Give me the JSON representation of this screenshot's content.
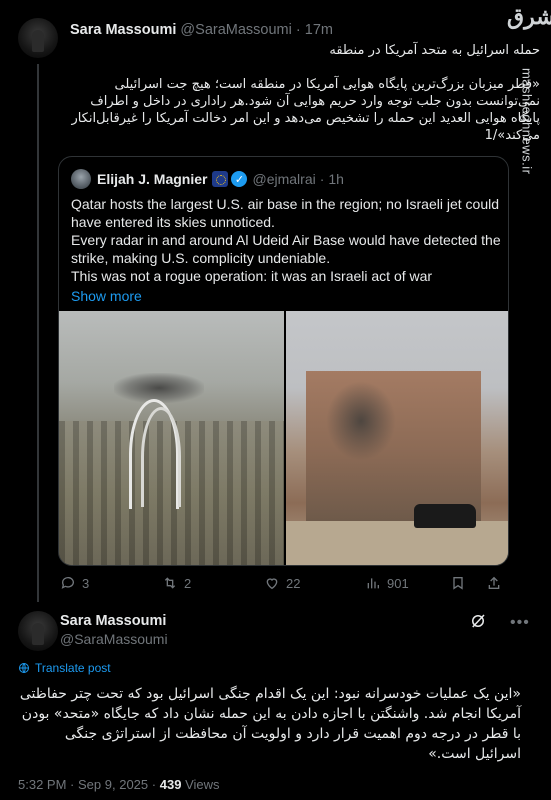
{
  "watermark": {
    "logo": "مشرق",
    "url": "mashreghnews.ir"
  },
  "tweet1": {
    "name": "Sara Massoumi",
    "handle": "@SaraMassoumi",
    "separator": "·",
    "time": "17m",
    "paragraphs": [
      "حمله اسرائیل به متحد آمریکا در منطقه",
      "«قطر میزبان بزرگ‌ترین پایگاه هوایی آمریکا در منطقه است؛ هیچ جت اسرائیلی نمی‌توانست بدون جلب توجه وارد حریم هوایی آن شود.هر راداری در داخل و اطراف پایگاه هوایی العدید این حمله را تشخیص می‌دهد و این امر دخالت آمریکا را غیرقابل‌انکار می‌کند»/1"
    ],
    "quote": {
      "name": "Elijah J. Magnier",
      "handle": "@ejmalrai",
      "separator": "·",
      "time": "1h",
      "lines": [
        "Qatar hosts the largest U.S. air base in the region; no Israeli jet could",
        "have entered its skies unnoticed.",
        "Every radar in and around Al Udeid Air Base would have detected the",
        "strike, making U.S. complicity undeniable.",
        "This was not a rogue operation: it was an Israeli act of war"
      ],
      "show_more": "Show more"
    },
    "actions": {
      "replies": "3",
      "reposts": "2",
      "likes": "22",
      "views": "901"
    }
  },
  "tweet2": {
    "name": "Sara Massoumi",
    "handle": "@SaraMassoumi",
    "translate": "Translate post",
    "text": "«این یک عملیات خودسرانه نبود: این یک اقدام جنگی اسرائیل بود که تحت چتر حفاظتی آمریکا انجام شد. واشنگتن با اجازه دادن به این حمله نشان داد که جایگاه «متحد» بودن با قطر در درجه دوم اهمیت قرار دارد و اولویت آن محافظت از استراتژی جنگی اسرائیل است.»",
    "time": "5:32 PM",
    "separator": "·",
    "date": "Sep 9, 2025",
    "views_count": "439",
    "views_label": "Views"
  },
  "colors": {
    "accent": "#1d9bf0",
    "muted": "#71767b",
    "text": "#e7e9ea",
    "background": "#000000"
  }
}
